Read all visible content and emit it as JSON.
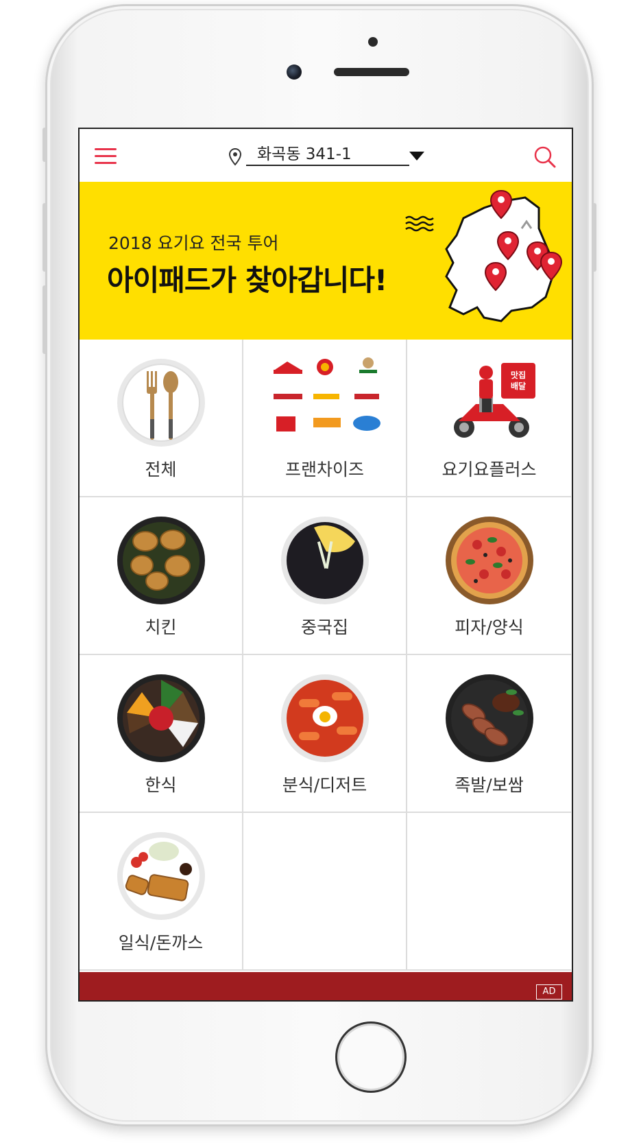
{
  "header": {
    "address": "화곡동 341-1"
  },
  "banner": {
    "subtitle": "2018 요기요 전국 투어",
    "title": "아이패드가 찾아갑니다!"
  },
  "categories": [
    {
      "label": "전체"
    },
    {
      "label": "프랜차이즈"
    },
    {
      "label": "요기요플러스"
    },
    {
      "label": "치킨"
    },
    {
      "label": "중국집"
    },
    {
      "label": "피자/양식"
    },
    {
      "label": "한식"
    },
    {
      "label": "분식/디저트"
    },
    {
      "label": "족발/보쌈"
    },
    {
      "label": "일식/돈까스"
    }
  ],
  "plus_badge": "맛집\n배달",
  "ad": {
    "tag": "AD"
  },
  "colors": {
    "accent": "#e8334a",
    "banner_bg": "#ffdf00",
    "ad_bg": "#9e1c1f"
  }
}
